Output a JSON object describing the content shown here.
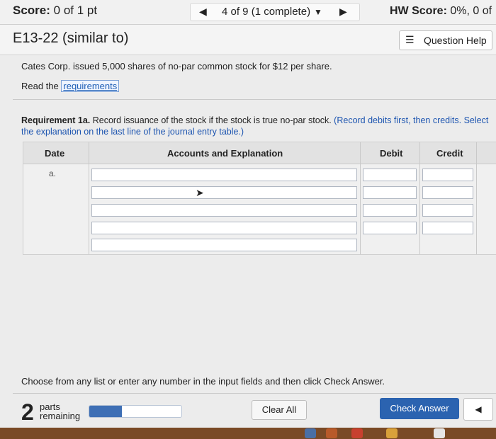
{
  "header": {
    "score_label": "Score:",
    "score_value": "0 of 1 pt",
    "nav_text": "4 of 9 (1 complete)",
    "hw_label": "HW Score:",
    "hw_value": "0%, 0 of"
  },
  "title": {
    "exercise": "E13-22 (similar to)",
    "help_button": "Question Help"
  },
  "problem": {
    "text": "Cates Corp. issued 5,000 shares of no-par common stock for $12 per share.",
    "read_prefix": "Read the",
    "requirements_link": "requirements",
    "requirement_bold": "Requirement 1a.",
    "requirement_text": " Record issuance of the stock if the stock is true no-par stock. ",
    "requirement_instruction": "(Record debits first, then credits. Select the explanation on the last line of the journal entry table.)"
  },
  "journal": {
    "headers": {
      "date": "Date",
      "account": "Accounts and Explanation",
      "debit": "Debit",
      "credit": "Credit"
    },
    "row_label": "a.",
    "rows": [
      {
        "account": "",
        "debit": "",
        "credit": ""
      },
      {
        "account": "",
        "debit": "",
        "credit": ""
      },
      {
        "account": "",
        "debit": "",
        "credit": ""
      },
      {
        "account": "",
        "debit": "",
        "credit": ""
      },
      {
        "account": ""
      }
    ]
  },
  "footer": {
    "instructions": "Choose from any list or enter any number in the input fields and then click Check Answer.",
    "parts_number": "2",
    "parts_line1": "parts",
    "parts_line2": "remaining",
    "progress_fraction": 0.35,
    "clear_all": "Clear All",
    "check_answer": "Check Answer"
  },
  "colors": {
    "accent": "#2b63b0",
    "link": "#1d55b0"
  }
}
